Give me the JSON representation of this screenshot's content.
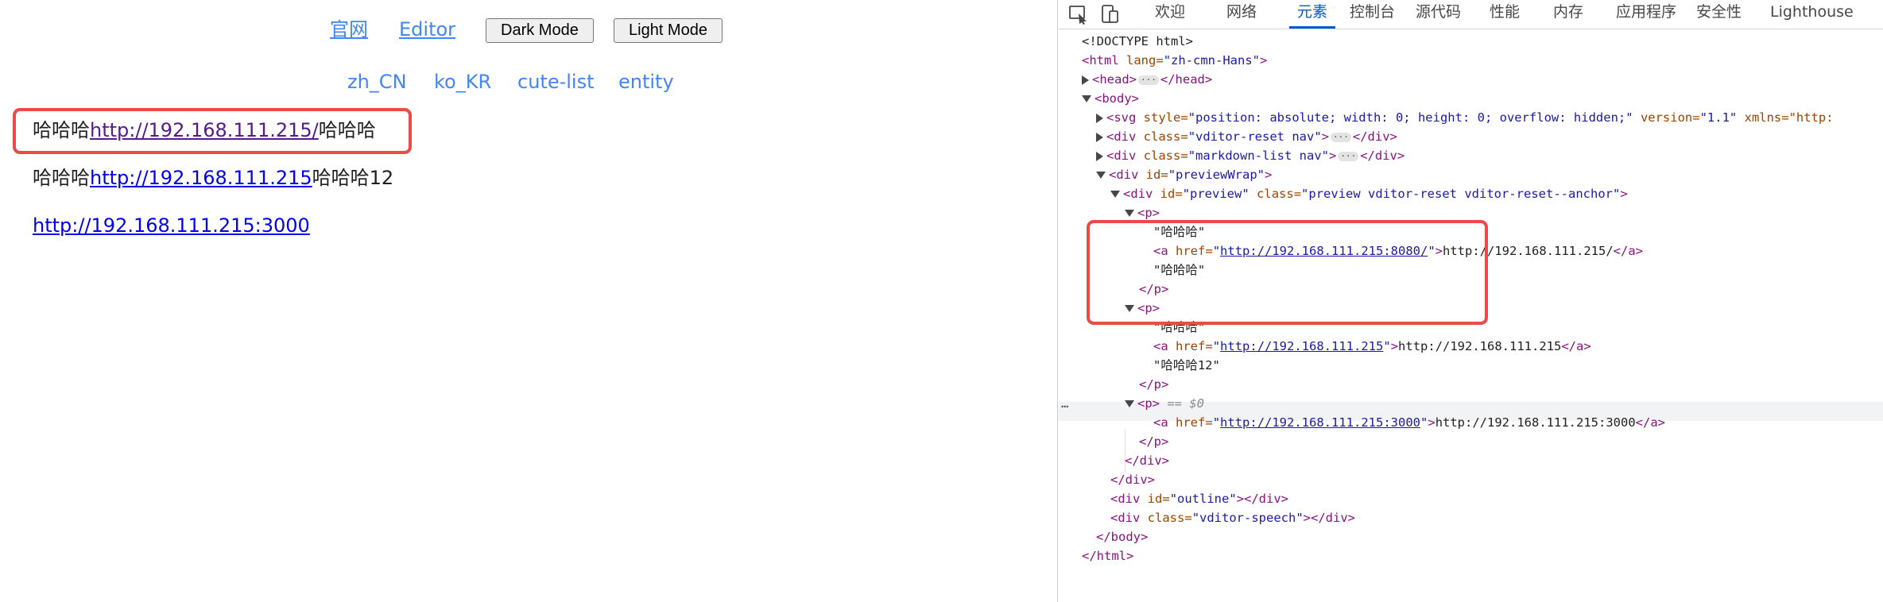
{
  "preview": {
    "top_links": [
      "官网",
      "Editor"
    ],
    "buttons": [
      "Dark Mode",
      "Light Mode"
    ],
    "nav_links": [
      "zh_CN",
      "ko_KR",
      "cute-list",
      "entity"
    ],
    "p1": {
      "before": "哈哈哈",
      "link": "http://192.168.111.215/",
      "after": "哈哈哈"
    },
    "p2": {
      "before": "哈哈哈",
      "link": "http://192.168.111.215",
      "after": "哈哈哈12"
    },
    "p3": {
      "link": "http://192.168.111.215:3000"
    }
  },
  "devtools": {
    "tabs": [
      "欢迎",
      "网络",
      "元素",
      "控制台",
      "源代码",
      "性能",
      "内存",
      "应用程序",
      "安全性",
      "Lighthouse"
    ],
    "active_tab": "元素",
    "dom": {
      "doctype": "<!DOCTYPE html>",
      "html_open": "<html",
      "html_lang_attr": "lang",
      "html_lang_val": "\"zh-cmn-Hans\"",
      "head": "<head>",
      "head_close": "</head>",
      "body": "<body>",
      "svg_tag": "<svg",
      "svg_style_attr": "style=",
      "svg_style_val": "\"position: absolute; width: 0; height: 0; overflow: hidden;\"",
      "svg_version_attr": "version=",
      "svg_version_val": "\"1.1\"",
      "svg_xmlns": "xmlns=\"http:",
      "div1_class": "\"vditor-reset nav\"",
      "div2_class": "\"markdown-list nav\"",
      "previewwrap_id": "\"previewWrap\"",
      "preview_id": "\"preview\"",
      "preview_class": "\"preview vditor-reset vditor-reset--anchor\"",
      "p_open": "<p>",
      "p_close": "</p>",
      "text_hahaha": "\"哈哈哈\"",
      "a1_href": "http://192.168.111.215:8080/",
      "a1_text": "http://192.168.111.215/",
      "a2_href": "http://192.168.111.215",
      "a2_text": "http://192.168.111.215",
      "text_hahaha12": "\"哈哈哈12\"",
      "selected_marker": "== $0",
      "a3_href": "http://192.168.111.215:3000",
      "a3_text": "http://192.168.111.215:3000",
      "div_close": "</div>",
      "outline_id": "\"outline\"",
      "speech_class": "\"vditor-speech\"",
      "body_close": "</body>",
      "html_close": "</html>",
      "dots": "…"
    }
  },
  "colors": {
    "highlight": "#ea4a4a",
    "link_blue": "#4285f4",
    "tab_active": "#0b57d0"
  }
}
